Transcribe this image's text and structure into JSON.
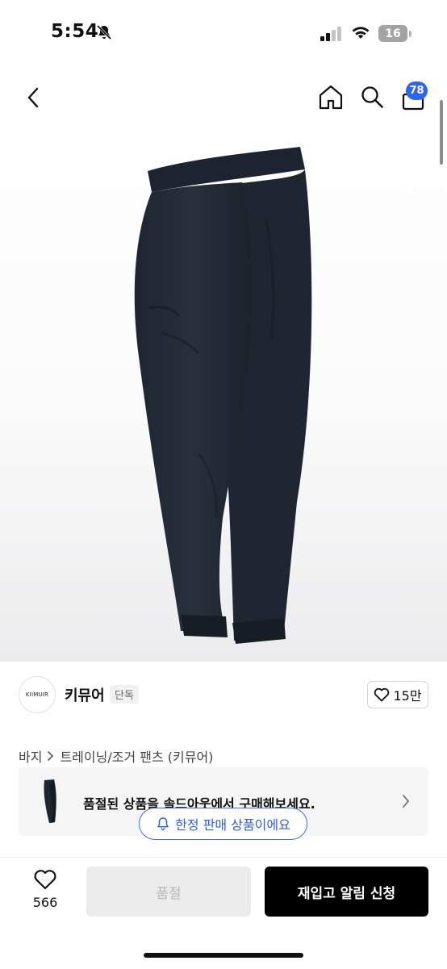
{
  "status": {
    "time": "5:54",
    "battery": "16"
  },
  "nav": {
    "cart_count": "78"
  },
  "brand": {
    "logo_text": "KIIMUIR",
    "name": "키뮤어",
    "tag": "단독",
    "like_count": "15만"
  },
  "breadcrumb": {
    "category": "바지",
    "subcategory": "트레이닝/조거 팬츠 (키뮤어)"
  },
  "soldout_banner": {
    "text": "품절된 상품을 솔드아웃에서 구매해보세요."
  },
  "limited_badge": {
    "text": "한정 판매 상품이에요"
  },
  "bottom": {
    "wish_count": "566",
    "soldout_label": "품절",
    "restock_label": "재입고 알림 신청"
  },
  "colors": {
    "accent": "#2f64f0",
    "primary": "#000000"
  }
}
